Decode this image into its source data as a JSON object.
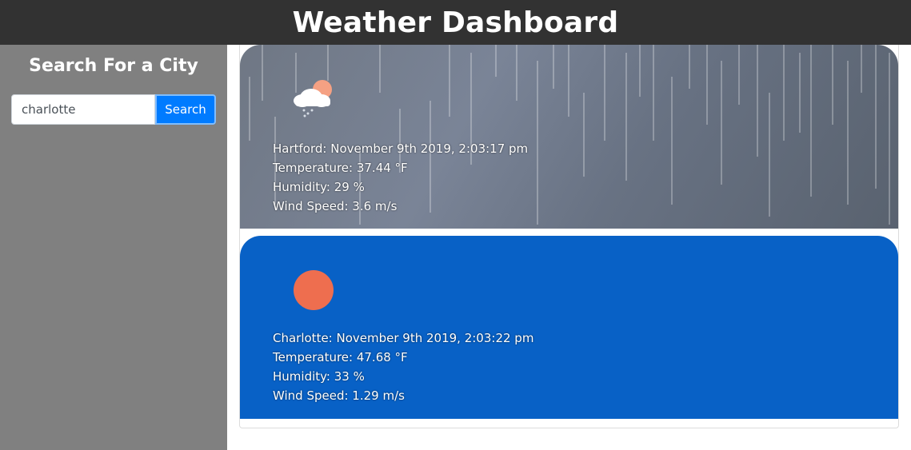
{
  "header": {
    "title": "Weather Dashboard"
  },
  "sidebar": {
    "heading": "Search For a City",
    "search_value": "charlotte",
    "search_button_label": "Search"
  },
  "cards": [
    {
      "icon": "rain-cloud-sun-icon",
      "title": "Hartford: November 9th 2019, 2:03:17 pm",
      "temperature": "Temperature: 37.44 °F",
      "humidity": "Humidity: 29 %",
      "wind": "Wind Speed: 3.6 m/s"
    },
    {
      "icon": "sun-icon",
      "title": "Charlotte: November 9th 2019, 2:03:22 pm",
      "temperature": "Temperature: 47.68 °F",
      "humidity": "Humidity: 33 %",
      "wind": "Wind Speed: 1.29 m/s"
    }
  ],
  "colors": {
    "header_bg": "#323232",
    "sidebar_bg": "#808080",
    "search_button_bg": "#007bff",
    "sunny_card_bg": "#0861c6",
    "sun_color": "#ee6e4f"
  }
}
